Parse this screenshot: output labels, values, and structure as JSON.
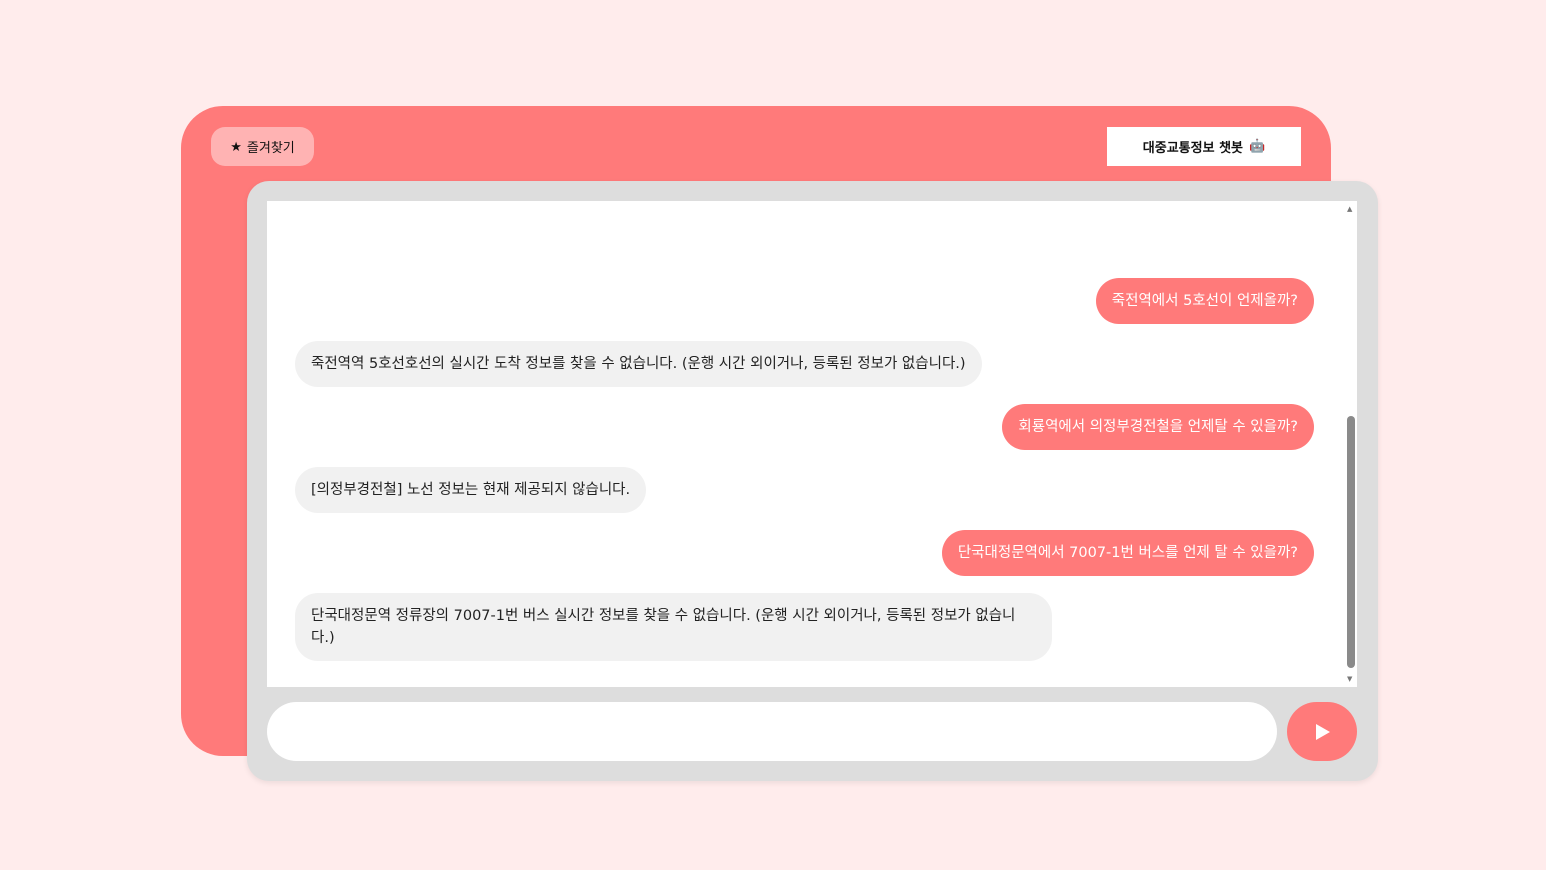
{
  "header": {
    "favorites_label": "즐겨찾기",
    "favorites_icon": "star-icon",
    "title": "대중교통정보 챗봇",
    "title_icon": "🤖"
  },
  "messages": [
    {
      "role": "user",
      "text": "죽전역에서 5호선이 언제올까?"
    },
    {
      "role": "bot",
      "text": "죽전역역 5호선호선의 실시간 도착 정보를 찾을 수 없습니다. (운행 시간 외이거나, 등록된 정보가 없습니다.)"
    },
    {
      "role": "user",
      "text": "회룡역에서 의정부경전철을 언제탈 수 있을까?"
    },
    {
      "role": "bot",
      "text": "[의정부경전철] 노선 정보는 현재 제공되지 않습니다."
    },
    {
      "role": "user",
      "text": "단국대정문역에서 7007-1번 버스를 언제 탈 수 있을까?"
    },
    {
      "role": "bot",
      "text": "단국대정문역 정류장의 7007-1번 버스 실시간 정보를 찾을 수 없습니다. (운행 시간 외이거나, 등록된 정보가 없습니다.)"
    }
  ],
  "input": {
    "value": "",
    "placeholder": ""
  },
  "send_icon": "play-icon",
  "colors": {
    "accent": "#ff7a7a",
    "background": "#ffecec",
    "bot_bubble": "#f1f1f1"
  }
}
